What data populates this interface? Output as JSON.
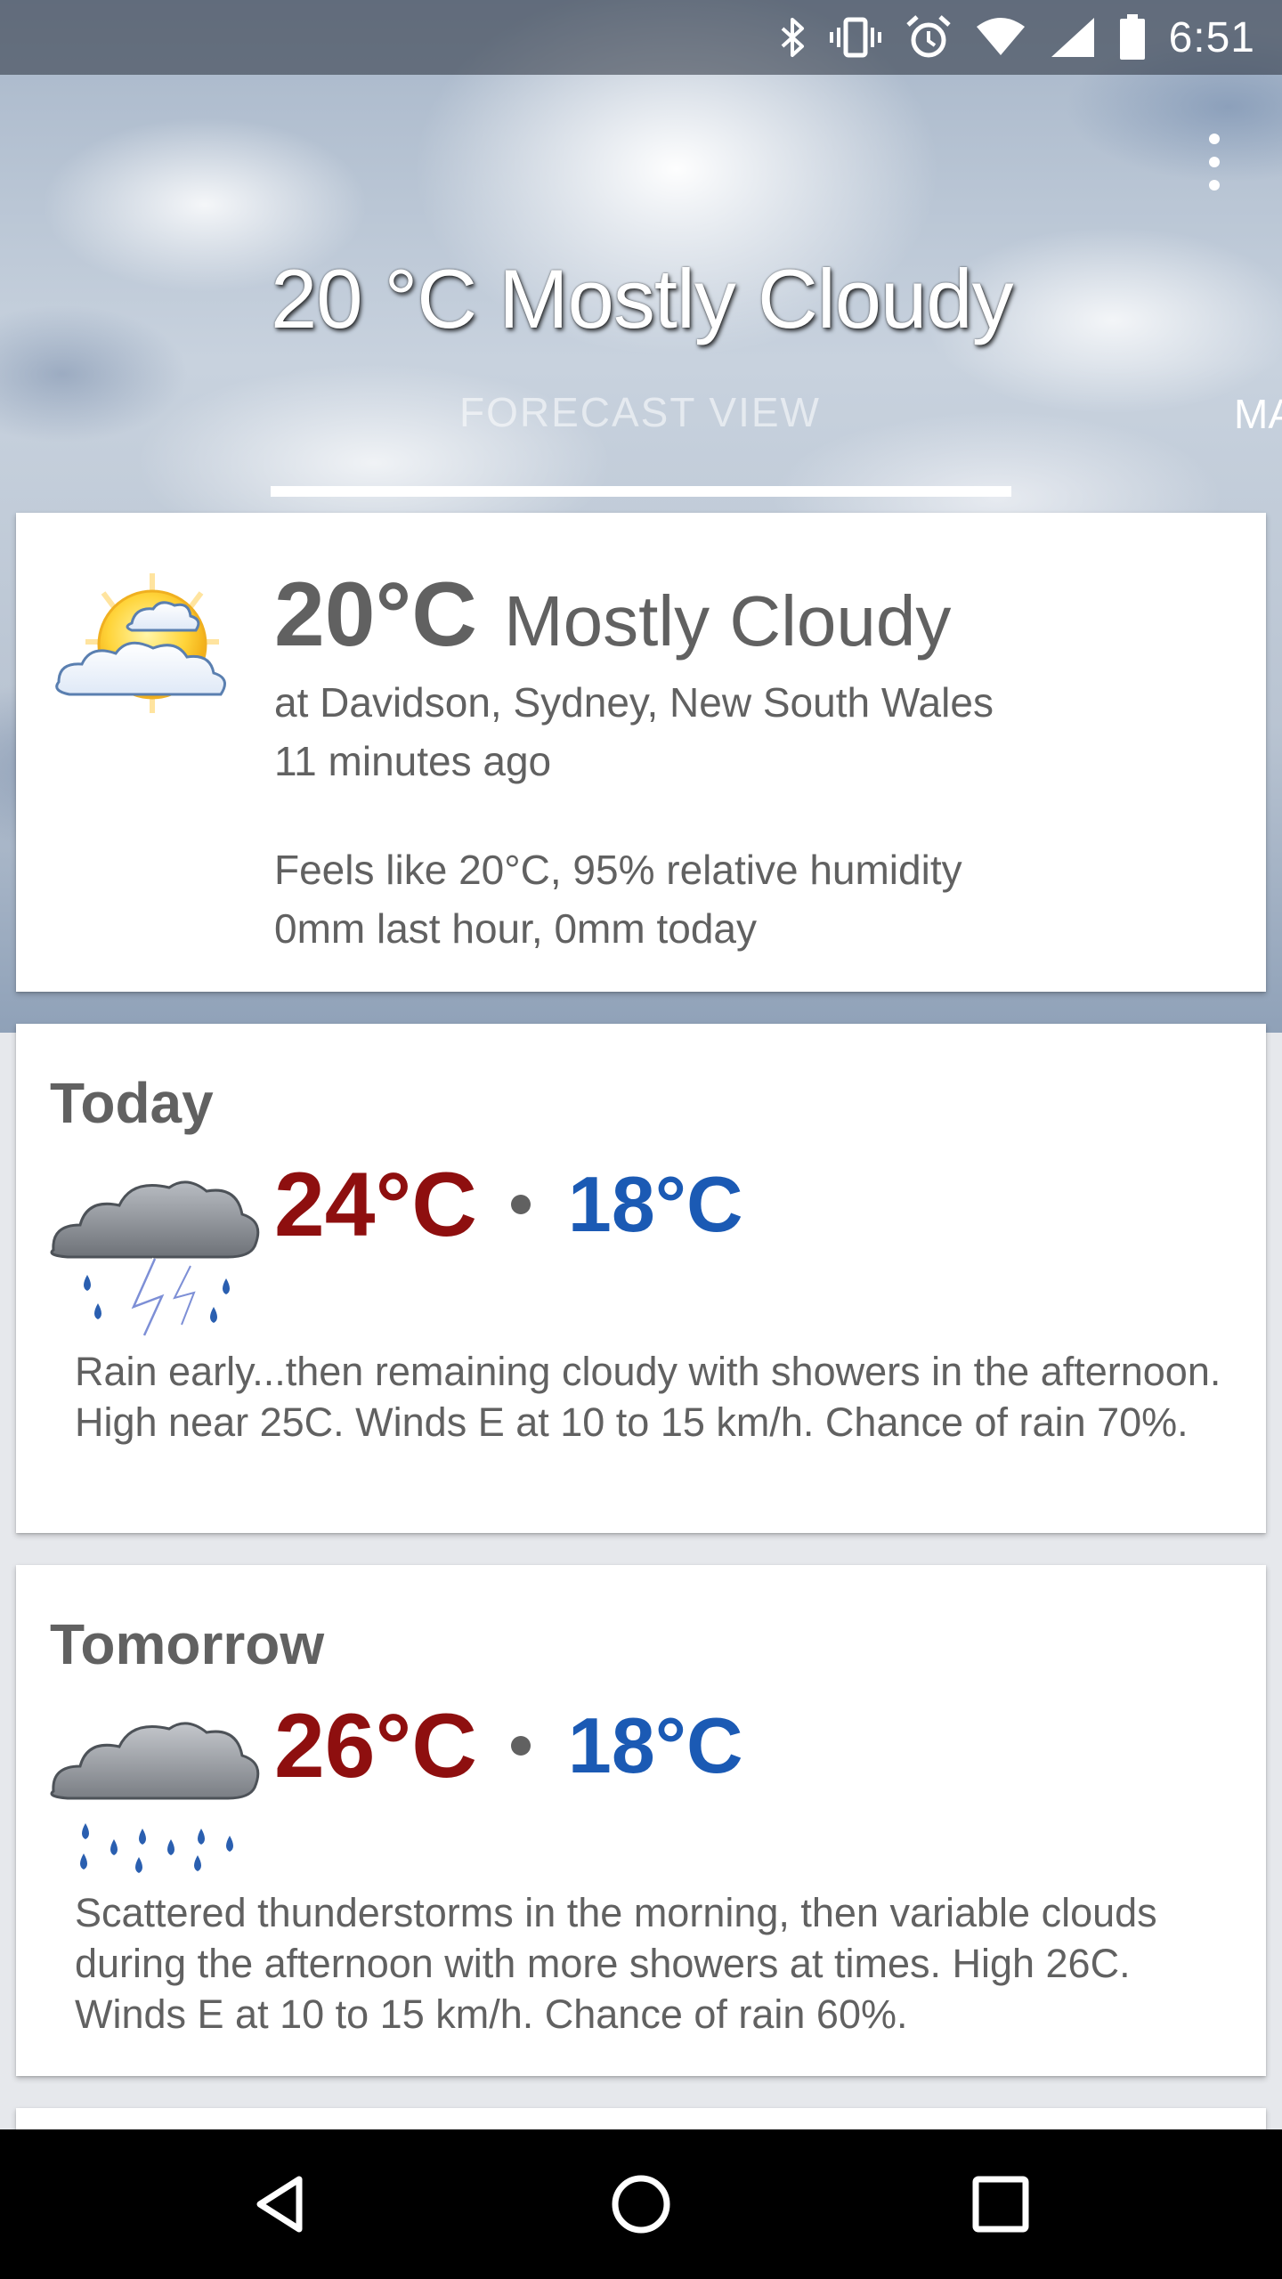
{
  "status_bar": {
    "time": "6:51",
    "icons": [
      "bluetooth-icon",
      "vibrate-icon",
      "alarm-icon",
      "wifi-icon",
      "cell-signal-icon",
      "battery-icon"
    ]
  },
  "header": {
    "title": "20 °C Mostly Cloudy",
    "tab_current": "FORECAST VIEW",
    "tab_next_partial": "MA"
  },
  "current": {
    "icon": "mostly-cloudy-sun-icon",
    "temp": "20°C",
    "condition": "Mostly Cloudy",
    "location": "at Davidson, Sydney, New South Wales",
    "updated": "11 minutes ago",
    "feels_like": "Feels like 20°C, 95% relative humidity",
    "rain": "0mm last hour, 0mm today"
  },
  "forecast": [
    {
      "day": "Today",
      "icon": "thunderstorm-icon",
      "high": "24°C",
      "low": "18°C",
      "description": "Rain early...then remaining cloudy with showers in the afternoon. High near 25C. Winds E at 10 to 15 km/h. Chance of rain 70%."
    },
    {
      "day": "Tomorrow",
      "icon": "rain-showers-icon",
      "high": "26°C",
      "low": "18°C",
      "description": "Scattered thunderstorms in the morning, then variable clouds during the afternoon with more showers at times. High 26C. Winds E at 10 to 15 km/h. Chance of rain 60%."
    }
  ],
  "colors": {
    "high_temp": "#8e0f0f",
    "low_temp": "#1b5ab4",
    "text": "#616161"
  },
  "nav": [
    "back-icon",
    "home-icon",
    "recents-icon"
  ]
}
